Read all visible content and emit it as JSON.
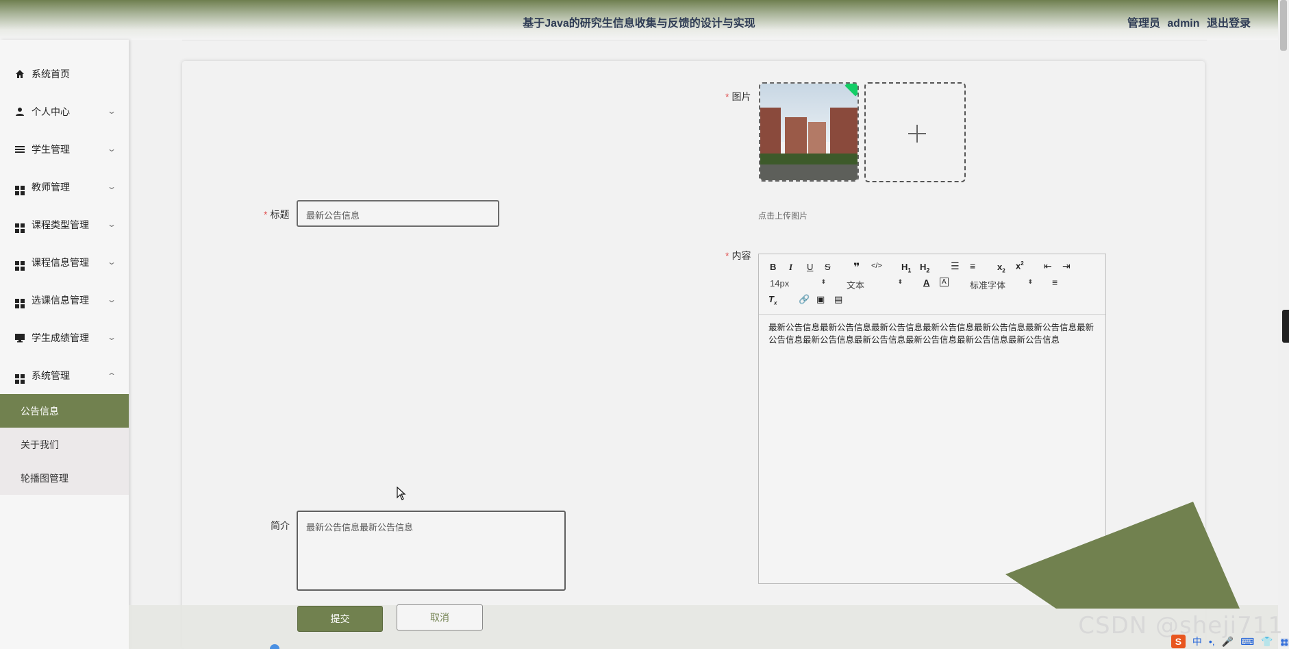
{
  "header": {
    "title": "基于Java的研究生信息收集与反馈的设计与实现",
    "role": "管理员",
    "username": "admin",
    "logout_label": "退出登录"
  },
  "sidebar": {
    "items": [
      {
        "label": "系统首页",
        "icon": "home-icon"
      },
      {
        "label": "个人中心",
        "icon": "user-icon"
      },
      {
        "label": "学生管理",
        "icon": "list-icon"
      },
      {
        "label": "教师管理",
        "icon": "grid-icon"
      },
      {
        "label": "课程类型管理",
        "icon": "grid-icon"
      },
      {
        "label": "课程信息管理",
        "icon": "grid-icon"
      },
      {
        "label": "选课信息管理",
        "icon": "grid-icon"
      },
      {
        "label": "学生成绩管理",
        "icon": "monitor-icon"
      },
      {
        "label": "系统管理",
        "icon": "grid-icon"
      }
    ],
    "sub_items": [
      {
        "label": "公告信息",
        "active": true
      },
      {
        "label": "关于我们",
        "active": false
      },
      {
        "label": "轮播图管理",
        "active": false
      }
    ]
  },
  "form": {
    "title_label": "标题",
    "title_value": "最新公告信息",
    "image_label": "图片",
    "upload_tip": "点击上传图片",
    "content_label": "内容",
    "content_value": "最新公告信息最新公告信息最新公告信息最新公告信息最新公告信息最新公告信息最新公告信息最新公告信息最新公告信息最新公告信息最新公告信息最新公告信息",
    "intro_label": "简介",
    "intro_value": "最新公告信息最新公告信息",
    "submit_label": "提交",
    "cancel_label": "取消"
  },
  "editor": {
    "font_size": "14px",
    "block_type": "文本",
    "font_family": "标准字体"
  },
  "watermark": "CSDN @sheji711",
  "ime": {
    "lang": "中"
  },
  "colors": {
    "accent": "#71814f",
    "required": "#e05050"
  }
}
